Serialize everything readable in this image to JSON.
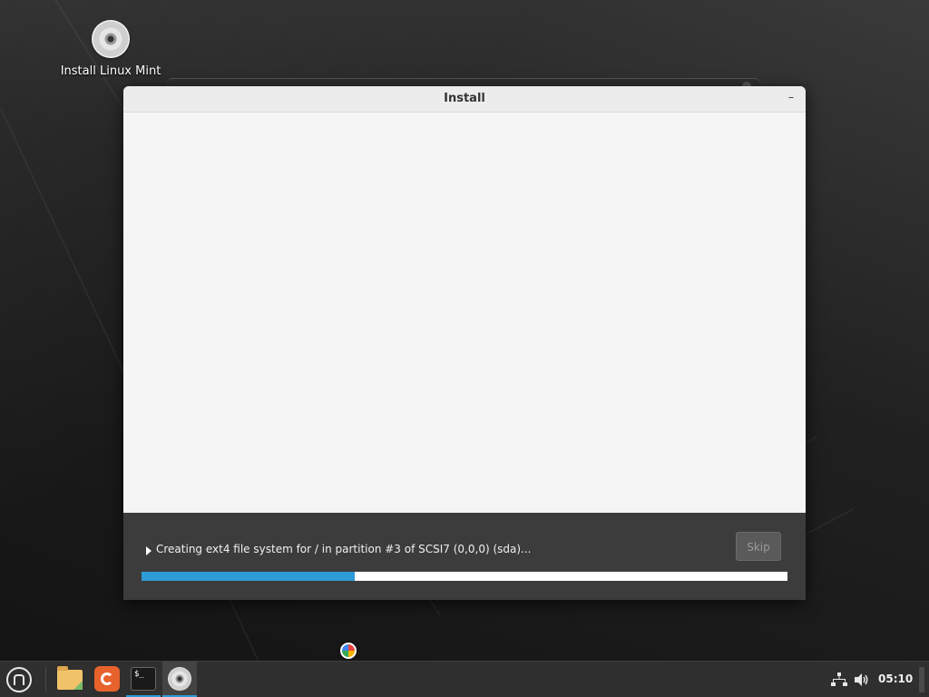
{
  "desktop": {
    "icons": [
      {
        "label": "Install Linux Mint",
        "icon": "disc-icon"
      }
    ]
  },
  "window": {
    "title": "Install",
    "minimize_glyph": "–",
    "status_text": "Creating ext4 file system for / in partition #3 of SCSI7 (0,0,0) (sda)...",
    "skip_label": "Skip",
    "progress_fraction": 0.33,
    "progress_color": "#2c9bd6"
  },
  "taskbar": {
    "menu_icon": "linux-mint-logo-icon",
    "launchers": [
      {
        "name": "files",
        "icon": "folder-icon"
      },
      {
        "name": "firefox",
        "icon": "firefox-icon"
      },
      {
        "name": "terminal",
        "icon": "terminal-icon",
        "glyph": "$_"
      },
      {
        "name": "installer",
        "icon": "disc-icon",
        "active": true
      }
    ],
    "tray": {
      "network_icon": "network-icon",
      "volume_icon": "volume-icon",
      "clock": "05:10"
    }
  }
}
